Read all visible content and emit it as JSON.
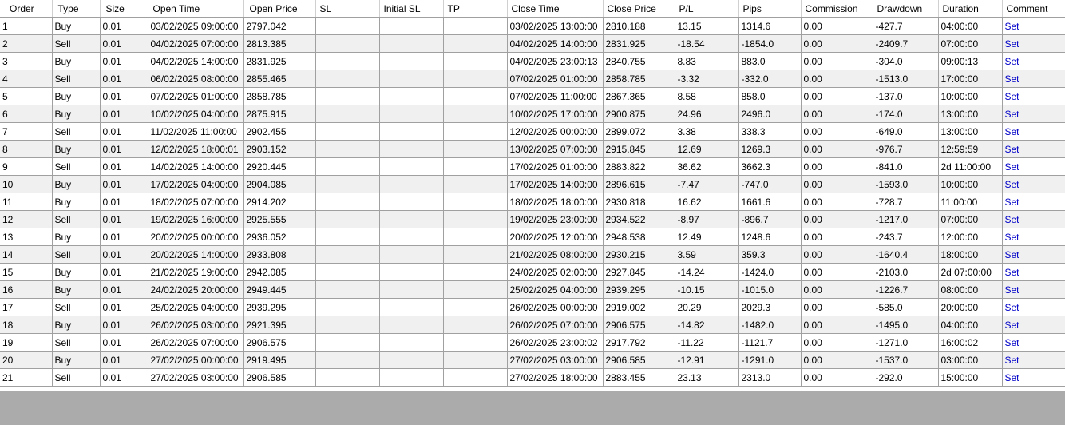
{
  "columns": [
    "Order",
    "Type",
    "Size",
    "Open Time",
    "Open Price",
    "SL",
    "Initial SL",
    "TP",
    "Close Time",
    "Close Price",
    "P/L",
    "Pips",
    "Commission",
    "Drawdown",
    "Duration",
    "Comment"
  ],
  "rows": [
    [
      "1",
      "Buy",
      "0.01",
      "03/02/2025 09:00:00",
      "2797.042",
      "",
      "",
      "",
      "03/02/2025 13:00:00",
      "2810.188",
      "13.15",
      "1314.6",
      "0.00",
      "-427.7",
      "04:00:00",
      "Set"
    ],
    [
      "2",
      "Sell",
      "0.01",
      "04/02/2025 07:00:00",
      "2813.385",
      "",
      "",
      "",
      "04/02/2025 14:00:00",
      "2831.925",
      "-18.54",
      "-1854.0",
      "0.00",
      "-2409.7",
      "07:00:00",
      "Set"
    ],
    [
      "3",
      "Buy",
      "0.01",
      "04/02/2025 14:00:00",
      "2831.925",
      "",
      "",
      "",
      "04/02/2025 23:00:13",
      "2840.755",
      "8.83",
      "883.0",
      "0.00",
      "-304.0",
      "09:00:13",
      "Set"
    ],
    [
      "4",
      "Sell",
      "0.01",
      "06/02/2025 08:00:00",
      "2855.465",
      "",
      "",
      "",
      "07/02/2025 01:00:00",
      "2858.785",
      "-3.32",
      "-332.0",
      "0.00",
      "-1513.0",
      "17:00:00",
      "Set"
    ],
    [
      "5",
      "Buy",
      "0.01",
      "07/02/2025 01:00:00",
      "2858.785",
      "",
      "",
      "",
      "07/02/2025 11:00:00",
      "2867.365",
      "8.58",
      "858.0",
      "0.00",
      "-137.0",
      "10:00:00",
      "Set"
    ],
    [
      "6",
      "Buy",
      "0.01",
      "10/02/2025 04:00:00",
      "2875.915",
      "",
      "",
      "",
      "10/02/2025 17:00:00",
      "2900.875",
      "24.96",
      "2496.0",
      "0.00",
      "-174.0",
      "13:00:00",
      "Set"
    ],
    [
      "7",
      "Sell",
      "0.01",
      "11/02/2025 11:00:00",
      "2902.455",
      "",
      "",
      "",
      "12/02/2025 00:00:00",
      "2899.072",
      "3.38",
      "338.3",
      "0.00",
      "-649.0",
      "13:00:00",
      "Set"
    ],
    [
      "8",
      "Buy",
      "0.01",
      "12/02/2025 18:00:01",
      "2903.152",
      "",
      "",
      "",
      "13/02/2025 07:00:00",
      "2915.845",
      "12.69",
      "1269.3",
      "0.00",
      "-976.7",
      "12:59:59",
      "Set"
    ],
    [
      "9",
      "Sell",
      "0.01",
      "14/02/2025 14:00:00",
      "2920.445",
      "",
      "",
      "",
      "17/02/2025 01:00:00",
      "2883.822",
      "36.62",
      "3662.3",
      "0.00",
      "-841.0",
      "2d 11:00:00",
      "Set"
    ],
    [
      "10",
      "Buy",
      "0.01",
      "17/02/2025 04:00:00",
      "2904.085",
      "",
      "",
      "",
      "17/02/2025 14:00:00",
      "2896.615",
      "-7.47",
      "-747.0",
      "0.00",
      "-1593.0",
      "10:00:00",
      "Set"
    ],
    [
      "11",
      "Buy",
      "0.01",
      "18/02/2025 07:00:00",
      "2914.202",
      "",
      "",
      "",
      "18/02/2025 18:00:00",
      "2930.818",
      "16.62",
      "1661.6",
      "0.00",
      "-728.7",
      "11:00:00",
      "Set"
    ],
    [
      "12",
      "Sell",
      "0.01",
      "19/02/2025 16:00:00",
      "2925.555",
      "",
      "",
      "",
      "19/02/2025 23:00:00",
      "2934.522",
      "-8.97",
      "-896.7",
      "0.00",
      "-1217.0",
      "07:00:00",
      "Set"
    ],
    [
      "13",
      "Buy",
      "0.01",
      "20/02/2025 00:00:00",
      "2936.052",
      "",
      "",
      "",
      "20/02/2025 12:00:00",
      "2948.538",
      "12.49",
      "1248.6",
      "0.00",
      "-243.7",
      "12:00:00",
      "Set"
    ],
    [
      "14",
      "Sell",
      "0.01",
      "20/02/2025 14:00:00",
      "2933.808",
      "",
      "",
      "",
      "21/02/2025 08:00:00",
      "2930.215",
      "3.59",
      "359.3",
      "0.00",
      "-1640.4",
      "18:00:00",
      "Set"
    ],
    [
      "15",
      "Buy",
      "0.01",
      "21/02/2025 19:00:00",
      "2942.085",
      "",
      "",
      "",
      "24/02/2025 02:00:00",
      "2927.845",
      "-14.24",
      "-1424.0",
      "0.00",
      "-2103.0",
      "2d 07:00:00",
      "Set"
    ],
    [
      "16",
      "Buy",
      "0.01",
      "24/02/2025 20:00:00",
      "2949.445",
      "",
      "",
      "",
      "25/02/2025 04:00:00",
      "2939.295",
      "-10.15",
      "-1015.0",
      "0.00",
      "-1226.7",
      "08:00:00",
      "Set"
    ],
    [
      "17",
      "Sell",
      "0.01",
      "25/02/2025 04:00:00",
      "2939.295",
      "",
      "",
      "",
      "26/02/2025 00:00:00",
      "2919.002",
      "20.29",
      "2029.3",
      "0.00",
      "-585.0",
      "20:00:00",
      "Set"
    ],
    [
      "18",
      "Buy",
      "0.01",
      "26/02/2025 03:00:00",
      "2921.395",
      "",
      "",
      "",
      "26/02/2025 07:00:00",
      "2906.575",
      "-14.82",
      "-1482.0",
      "0.00",
      "-1495.0",
      "04:00:00",
      "Set"
    ],
    [
      "19",
      "Sell",
      "0.01",
      "26/02/2025 07:00:00",
      "2906.575",
      "",
      "",
      "",
      "26/02/2025 23:00:02",
      "2917.792",
      "-11.22",
      "-1121.7",
      "0.00",
      "-1271.0",
      "16:00:02",
      "Set"
    ],
    [
      "20",
      "Buy",
      "0.01",
      "27/02/2025 00:00:00",
      "2919.495",
      "",
      "",
      "",
      "27/02/2025 03:00:00",
      "2906.585",
      "-12.91",
      "-1291.0",
      "0.00",
      "-1537.0",
      "03:00:00",
      "Set"
    ],
    [
      "21",
      "Sell",
      "0.01",
      "27/02/2025 03:00:00",
      "2906.585",
      "",
      "",
      "",
      "27/02/2025 18:00:00",
      "2883.455",
      "23.13",
      "2313.0",
      "0.00",
      "-292.0",
      "15:00:00",
      "Set"
    ]
  ],
  "colors": {
    "link": "#0000c8",
    "row_alt": "#f0f0f0",
    "empty_area": "#ababab",
    "grid_line": "#a0a0a0"
  }
}
